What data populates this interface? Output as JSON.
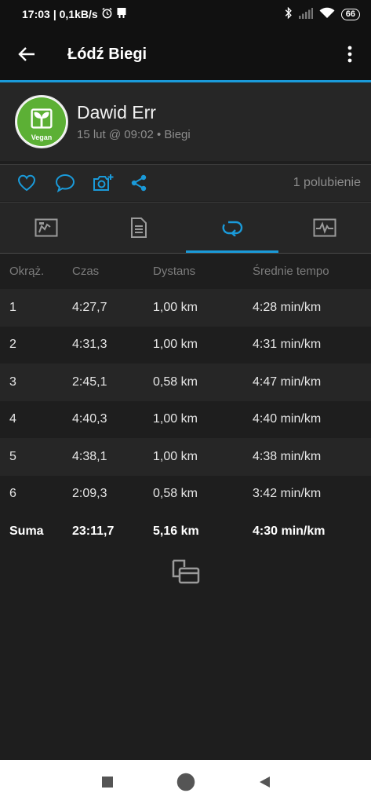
{
  "status_bar": {
    "time": "17:03",
    "network_speed": "| 0,1kB/s",
    "battery": "66"
  },
  "app_bar": {
    "title": "Łódź Biegi"
  },
  "profile": {
    "name": "Dawid Err",
    "meta": "15 lut @ 09:02 • Biegi",
    "avatar_text": "Vegan"
  },
  "actions": {
    "likes": "1 polubienie"
  },
  "tabs": [
    "overview-tab",
    "details-tab",
    "laps-tab",
    "charts-tab"
  ],
  "laps": {
    "headers": [
      "Okrąż.",
      "Czas",
      "Dystans",
      "Średnie tempo"
    ],
    "rows": [
      [
        "1",
        "4:27,7",
        "1,00 km",
        "4:28 min/km"
      ],
      [
        "2",
        "4:31,3",
        "1,00 km",
        "4:31 min/km"
      ],
      [
        "3",
        "2:45,1",
        "0,58 km",
        "4:47 min/km"
      ],
      [
        "4",
        "4:40,3",
        "1,00 km",
        "4:40 min/km"
      ],
      [
        "5",
        "4:38,1",
        "1,00 km",
        "4:38 min/km"
      ],
      [
        "6",
        "2:09,3",
        "0,58 km",
        "3:42 min/km"
      ]
    ],
    "total": [
      "Suma",
      "23:11,7",
      "5,16 km",
      "4:30 min/km"
    ]
  },
  "colors": {
    "accent": "#1a9ad9",
    "background": "#1e1e1e",
    "row_alt": "#262626"
  }
}
